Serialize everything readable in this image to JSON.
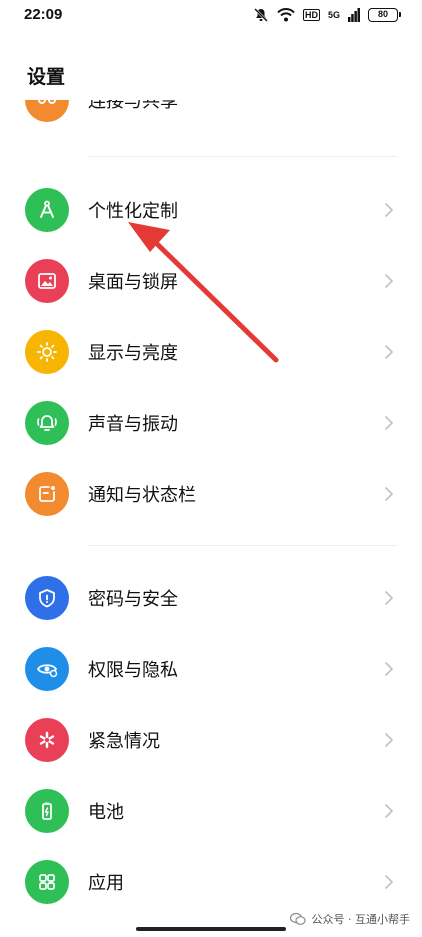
{
  "status": {
    "time": "22:09",
    "hd": "HD",
    "signal": "5G",
    "battery": "80"
  },
  "header": {
    "title": "设置"
  },
  "items": {
    "connect": {
      "label": "连接与共享",
      "color": "#f28a30",
      "icon": "share-icon"
    },
    "personalize": {
      "label": "个性化定制",
      "color": "#2fbf57",
      "icon": "compass-icon"
    },
    "desktop": {
      "label": "桌面与锁屏",
      "color": "#e94058",
      "icon": "image-icon"
    },
    "display": {
      "label": "显示与亮度",
      "color": "#f5b500",
      "icon": "sun-icon"
    },
    "sound": {
      "label": "声音与振动",
      "color": "#2fbf57",
      "icon": "bell-icon"
    },
    "notify": {
      "label": "通知与状态栏",
      "color": "#f28a30",
      "icon": "notification-icon"
    },
    "security": {
      "label": "密码与安全",
      "color": "#2f6fe8",
      "icon": "shield-icon"
    },
    "privacy": {
      "label": "权限与隐私",
      "color": "#1f8ee8",
      "icon": "eye-icon"
    },
    "emergency": {
      "label": "紧急情况",
      "color": "#e94058",
      "icon": "asterisk-icon"
    },
    "battery": {
      "label": "电池",
      "color": "#2fbf57",
      "icon": "battery-icon"
    },
    "apps": {
      "label": "应用",
      "color": "#2fbf57",
      "icon": "apps-icon"
    }
  },
  "annotation": {
    "color": "#e53935"
  },
  "watermark": {
    "text": "公众号 · 互通小帮手"
  }
}
